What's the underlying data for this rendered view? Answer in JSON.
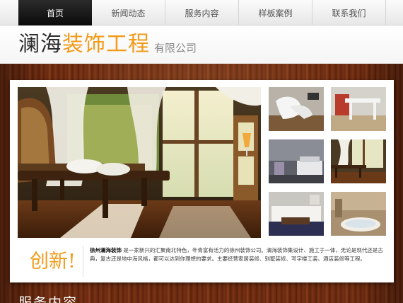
{
  "nav": {
    "items": [
      {
        "label": "首页",
        "active": true
      },
      {
        "label": "新闻动态",
        "active": false
      },
      {
        "label": "服务内容",
        "active": false
      },
      {
        "label": "样板案例",
        "active": false
      },
      {
        "label": "联系我们",
        "active": false
      }
    ]
  },
  "header": {
    "logo_main": "澜海",
    "logo_accent": "装饰工程",
    "logo_suffix": "有限公司"
  },
  "intro": {
    "tag": "创新!",
    "company": "徐州澜海装饰",
    "text": "是一家新兴的汇聚南北特色，年青富有活力的徐州装饰公司。澜海装饰集设计、施工于一体，无论是现代还是古典，复古还是地中海风格，都可以达到你理想的要求。主要经营家居装修、别墅装修、写字楼工装、酒店装修等工程。"
  },
  "section": {
    "title": "服务内容"
  },
  "colors": {
    "accent": "#f39a16",
    "nav_active": "#111111",
    "wood": "#6a2a10"
  }
}
